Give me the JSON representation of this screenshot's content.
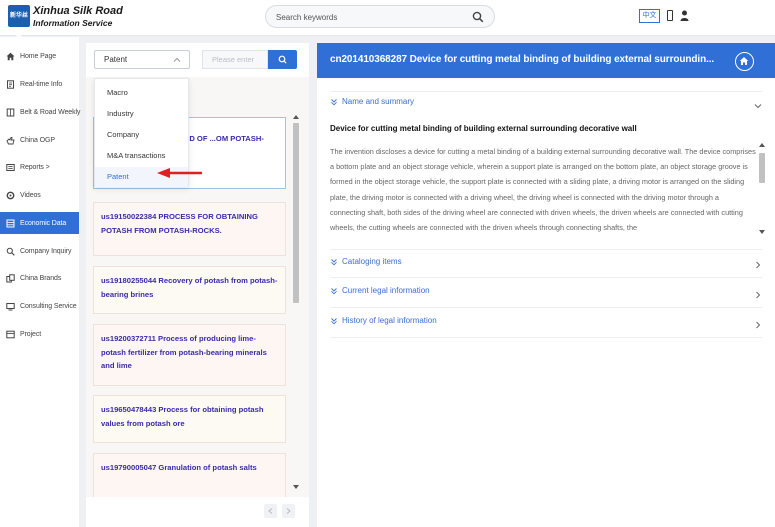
{
  "brand": {
    "logo_text": "新华丝路",
    "name": "Xinhua Silk Road",
    "subtitle": "Information Service"
  },
  "header": {
    "search_placeholder": "Search keywords",
    "lang_label": "中文"
  },
  "sidebar": {
    "items": [
      {
        "label": "Home Page",
        "icon": "home-icon"
      },
      {
        "label": "Real-time Info",
        "icon": "document-icon"
      },
      {
        "label": "Belt & Road Weekly",
        "icon": "book-icon"
      },
      {
        "label": "China OGP",
        "icon": "hand-icon"
      },
      {
        "label": "Reports >",
        "icon": "report-icon"
      },
      {
        "label": "Videos",
        "icon": "video-icon"
      },
      {
        "label": "Economic Data",
        "icon": "database-icon",
        "active": true
      },
      {
        "label": "Company Inquiry",
        "icon": "search-icon"
      },
      {
        "label": "China Brands",
        "icon": "brands-icon"
      },
      {
        "label": "Consulting Service",
        "icon": "consulting-icon"
      },
      {
        "label": "Project",
        "icon": "project-icon"
      }
    ]
  },
  "filter": {
    "selected_type": "Patent",
    "input_placeholder": "Please enter"
  },
  "dropdown": {
    "options": [
      "Macro",
      "Industry",
      "Company",
      "M&A transactions",
      "Patent"
    ],
    "selected": "Patent"
  },
  "list": {
    "items": [
      {
        "title": "...D OF ...OM POTASH-",
        "selected": true
      },
      {
        "title": "us19150022384 PROCESS FOR OBTAINING POTASH FROM POTASH-ROCKS."
      },
      {
        "title": "us19180255044 Recovery of potash from potash-bearing brines"
      },
      {
        "title": "us19200372711 Process of producing lime-potash fertilizer from potash-bearing minerals and lime"
      },
      {
        "title": "us19650478443 Process for obtaining potash values from potash ore"
      },
      {
        "title": "us19790005047 Granulation of potash salts"
      }
    ]
  },
  "detail": {
    "header_title": "cn201410368287 Device for cutting metal binding of building external surroundin...",
    "sections": {
      "name_summary": "Name and summary",
      "cataloging": "Cataloging items",
      "current_legal": "Current legal information",
      "history_legal": "History of legal information"
    },
    "summary_title": "Device for cutting metal binding of building external surrounding decorative wall",
    "summary_text": "The invention discloses a device for cutting a metal binding of a building external surrounding decorative wall. The device comprises a bottom plate and an object storage vehicle, wherein a support plate is arranged on the bottom plate, an object storage groove is formed in the object storage vehicle, the support plate is connected with a sliding plate, a driving motor is arranged on the sliding plate, the driving motor is connected with a driving wheel, the driving wheel is connected with the driving motor through a connecting shaft, both sides of the driving wheel are connected with driven wheels, the driven wheels are connected with cutting wheels, the cutting wheels are connected with the driven wheels through connecting shafts, the"
  },
  "colors": {
    "accent": "#2f6fd6",
    "list_title": "#3a2aa8",
    "annotation_arrow": "#e02020"
  }
}
